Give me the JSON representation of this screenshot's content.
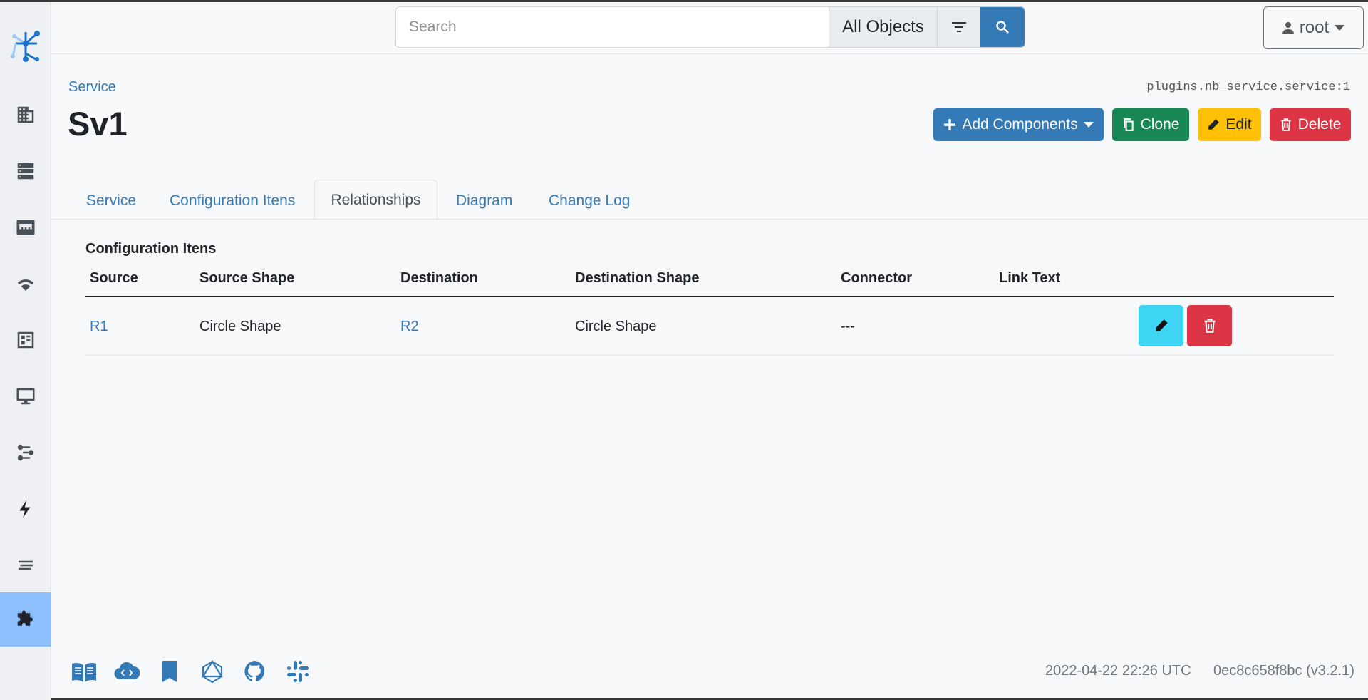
{
  "search": {
    "placeholder": "Search",
    "scope": "All Objects"
  },
  "user": {
    "name": "root"
  },
  "breadcrumb": {
    "label": "Service"
  },
  "object": {
    "id": "plugins.nb_service.service:1",
    "title": "Sv1"
  },
  "actions": {
    "add_components": "Add Components",
    "clone": "Clone",
    "edit": "Edit",
    "delete": "Delete"
  },
  "tabs": [
    {
      "label": "Service"
    },
    {
      "label": "Configuration Itens"
    },
    {
      "label": "Relationships",
      "active": true
    },
    {
      "label": "Diagram"
    },
    {
      "label": "Change Log"
    }
  ],
  "section": {
    "title": "Configuration Itens"
  },
  "table": {
    "columns": [
      "Source",
      "Source Shape",
      "Destination",
      "Destination Shape",
      "Connector",
      "Link Text"
    ],
    "rows": [
      {
        "source": "R1",
        "source_shape": "Circle Shape",
        "destination": "R2",
        "destination_shape": "Circle Shape",
        "connector": "---",
        "link_text": ""
      }
    ]
  },
  "sidebar": {
    "items": [
      "organization-icon",
      "devices-icon",
      "ipam-icon",
      "wireless-icon",
      "circuits-icon",
      "virtualization-icon",
      "connections-icon",
      "power-icon",
      "other-icon",
      "plugins-icon"
    ],
    "active": "plugins-icon"
  },
  "footer": {
    "icons": [
      "docs-icon",
      "api-icon",
      "api-docs-icon",
      "graphql-icon",
      "github-icon",
      "slack-icon"
    ],
    "timestamp": "2022-04-22 22:26 UTC",
    "version": "0ec8c658f8bc (v3.2.1)"
  },
  "colors": {
    "primary": "#337ab7",
    "success": "#198754",
    "warning": "#ffc107",
    "danger": "#dc3545",
    "info": "#3dd5f3",
    "sidebar_active": "#8ec0ff"
  }
}
